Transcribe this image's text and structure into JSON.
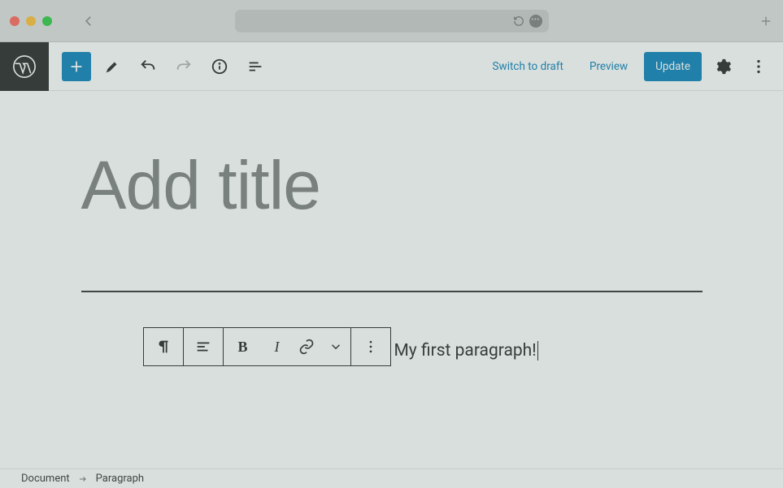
{
  "browser": {},
  "editor": {
    "switch_draft": "Switch to draft",
    "preview": "Preview",
    "update": "Update"
  },
  "post": {
    "title_placeholder": "Add title",
    "paragraph_text": "My first paragraph!"
  },
  "breadcrumb": {
    "root": "Document",
    "current": "Paragraph"
  },
  "block_toolbar": {
    "bold": "B",
    "italic": "I"
  }
}
